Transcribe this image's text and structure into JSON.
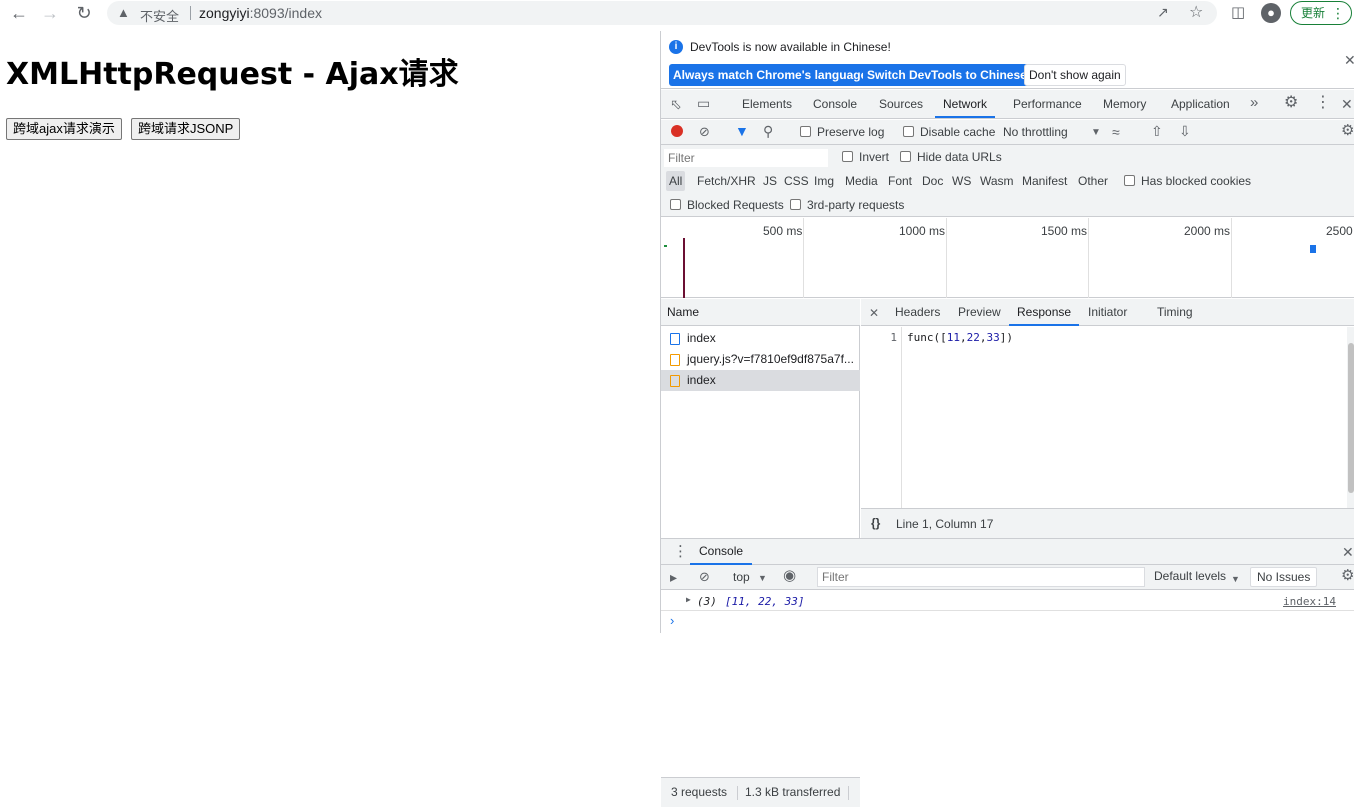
{
  "browser": {
    "insecure_label": "不安全",
    "url_host": "zongyiyi",
    "url_path": ":8093/index",
    "update_label": "更新"
  },
  "page": {
    "heading": "XMLHttpRequest - Ajax请求",
    "buttons": [
      "跨域ajax请求演示",
      "跨域请求JSONP"
    ]
  },
  "devtools": {
    "infobar": {
      "message": "DevTools is now available in Chinese!",
      "btn_match": "Always match Chrome's language",
      "btn_switch": "Switch DevTools to Chinese",
      "btn_dont_show": "Don't show again"
    },
    "tabs": [
      "Elements",
      "Console",
      "Sources",
      "Network",
      "Performance",
      "Memory",
      "Application"
    ],
    "active_tab": "Network",
    "network_toolbar": {
      "preserve_log": "Preserve log",
      "disable_cache": "Disable cache",
      "throttling": "No throttling"
    },
    "filter": {
      "placeholder": "Filter",
      "invert": "Invert",
      "hide_data_urls": "Hide data URLs",
      "types": [
        "All",
        "Fetch/XHR",
        "JS",
        "CSS",
        "Img",
        "Media",
        "Font",
        "Doc",
        "WS",
        "Wasm",
        "Manifest",
        "Other"
      ],
      "has_blocked_cookies": "Has blocked cookies",
      "blocked_requests": "Blocked Requests",
      "third_party": "3rd-party requests"
    },
    "overview_ticks": [
      "500 ms",
      "1000 ms",
      "1500 ms",
      "2000 ms",
      "2500"
    ],
    "requests": {
      "header": "Name",
      "items": [
        {
          "name": "index",
          "type": "doc",
          "selected": false
        },
        {
          "name": "jquery.js?v=f7810ef9df875a7f...",
          "type": "js",
          "selected": false
        },
        {
          "name": "index",
          "type": "js",
          "selected": true
        }
      ],
      "count": "3 requests",
      "transferred": "1.3 kB transferred"
    },
    "detail": {
      "tabs": [
        "Headers",
        "Preview",
        "Response",
        "Initiator",
        "Timing"
      ],
      "active_tab": "Response",
      "line_number": "1",
      "code_prefix": "func([",
      "code_values": [
        "11",
        "22",
        "33"
      ],
      "code_suffix": "])",
      "cursor_position": "Line 1, Column 17"
    },
    "drawer": {
      "title": "Console",
      "context": "top",
      "filter_placeholder": "Filter",
      "levels": "Default levels",
      "issues": "No Issues",
      "log_count": "(3)",
      "log_value": "[11, 22, 33]",
      "log_source": "index:14"
    }
  }
}
